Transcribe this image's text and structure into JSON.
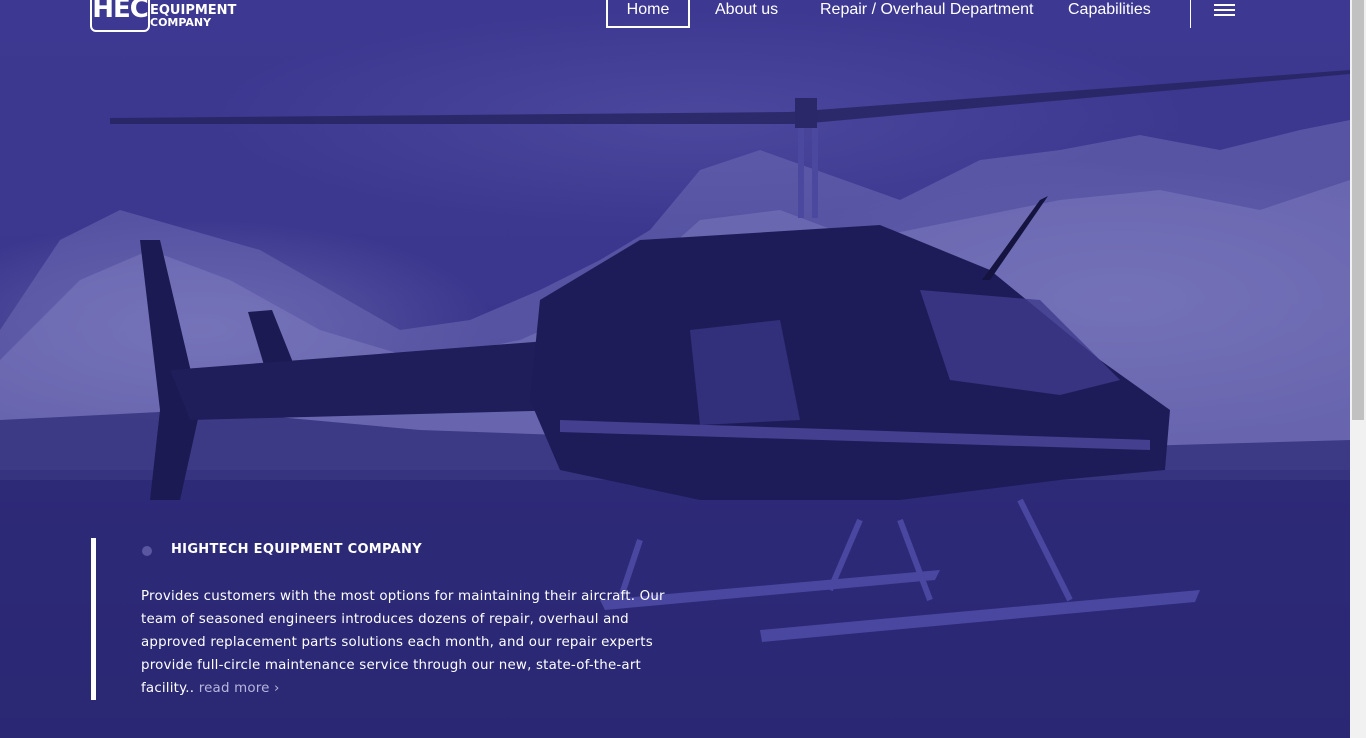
{
  "logo": {
    "mark": "HEC",
    "line1": "EQUIPMENT",
    "line2": "COMPANY"
  },
  "nav": {
    "home": "Home",
    "about": "About us",
    "repair": "Repair / Overhaul Department",
    "capabilities": "Capabilities"
  },
  "icons": {
    "menu": "hamburger-icon",
    "bullet": "circle-dot-icon"
  },
  "hero": {
    "title": "HIGHTECH EQUIPMENT COMPANY",
    "text": "Provides customers with the most options for maintaining their aircraft. Our team of seasoned engineers introduces dozens of repair, overhaul and approved replacement parts solutions each month, and our repair experts provide full-circle maintenance service through our new, state-of-the-art facility..",
    "read_more": "read more ›"
  },
  "colors": {
    "overlay": "#3b378e",
    "accent_text": "#b9b6df"
  }
}
